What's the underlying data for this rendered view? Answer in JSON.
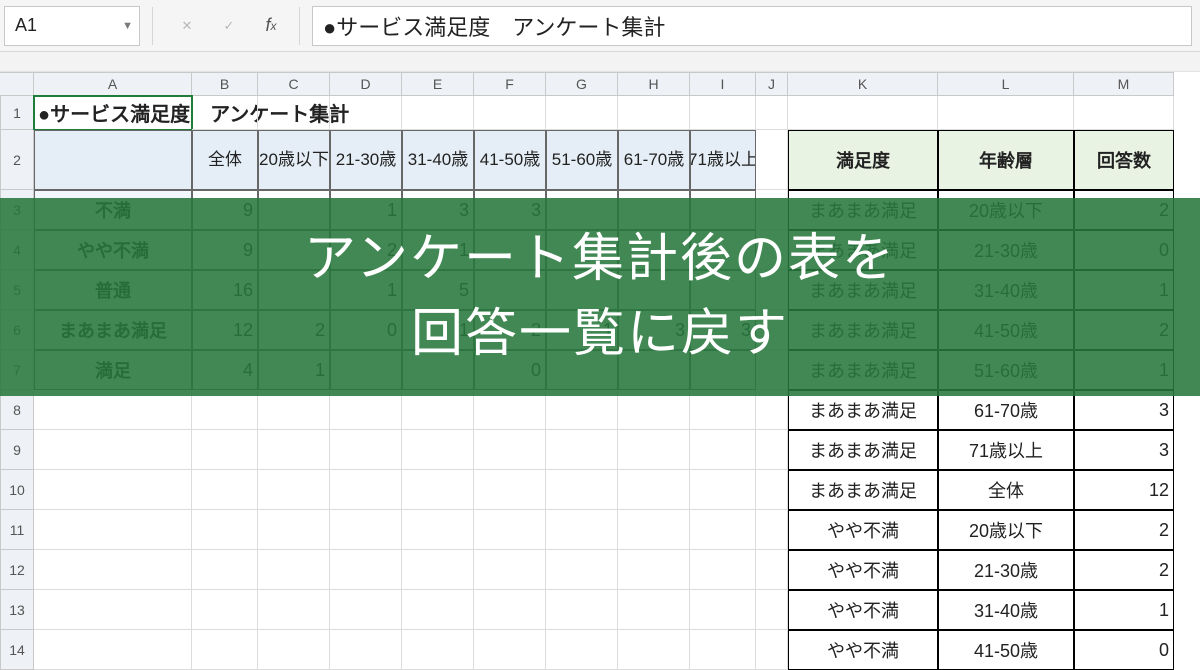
{
  "namebox": "A1",
  "formula": "●サービス満足度　アンケート集計",
  "columns": [
    "A",
    "B",
    "C",
    "D",
    "E",
    "F",
    "G",
    "H",
    "I",
    "J",
    "K",
    "L",
    "M"
  ],
  "crosstab": {
    "a1": "●サービス満足度　アンケート集計",
    "headers": [
      "全体",
      "20歳以下",
      "21-30歳",
      "31-40歳",
      "41-50歳",
      "51-60歳",
      "61-70歳",
      "71歳以上"
    ],
    "rows": [
      {
        "label": "不満",
        "vals": [
          9,
          "",
          1,
          3,
          3,
          "",
          "",
          ""
        ]
      },
      {
        "label": "やや不満",
        "vals": [
          9,
          "",
          2,
          1,
          "",
          "",
          "",
          ""
        ]
      },
      {
        "label": "普通",
        "vals": [
          16,
          "",
          1,
          5,
          "",
          "",
          "",
          ""
        ]
      },
      {
        "label": "まあまあ満足",
        "vals": [
          12,
          2,
          0,
          1,
          2,
          1,
          3,
          3
        ]
      },
      {
        "label": "満足",
        "vals": [
          4,
          1,
          "",
          "",
          0,
          "",
          "",
          ""
        ]
      }
    ]
  },
  "right": {
    "headers": [
      "満足度",
      "年齢層",
      "回答数"
    ],
    "rows": [
      [
        "まあまあ満足",
        "20歳以下",
        2
      ],
      [
        "まあまあ満足",
        "21-30歳",
        0
      ],
      [
        "まあまあ満足",
        "31-40歳",
        1
      ],
      [
        "まあまあ満足",
        "41-50歳",
        2
      ],
      [
        "まあまあ満足",
        "51-60歳",
        1
      ],
      [
        "まあまあ満足",
        "61-70歳",
        3
      ],
      [
        "まあまあ満足",
        "71歳以上",
        3
      ],
      [
        "まあまあ満足",
        "全体",
        12
      ],
      [
        "やや不満",
        "20歳以下",
        2
      ],
      [
        "やや不満",
        "21-30歳",
        2
      ],
      [
        "やや不満",
        "31-40歳",
        1
      ],
      [
        "やや不満",
        "41-50歳",
        0
      ]
    ]
  },
  "overlay": {
    "line1": "アンケート集計後の表を",
    "line2": "回答一覧に戻す"
  },
  "row_numbers": [
    "1",
    "2",
    "3",
    "4",
    "5",
    "6",
    "7",
    "8",
    "9",
    "10",
    "11",
    "12",
    "13",
    "14"
  ]
}
